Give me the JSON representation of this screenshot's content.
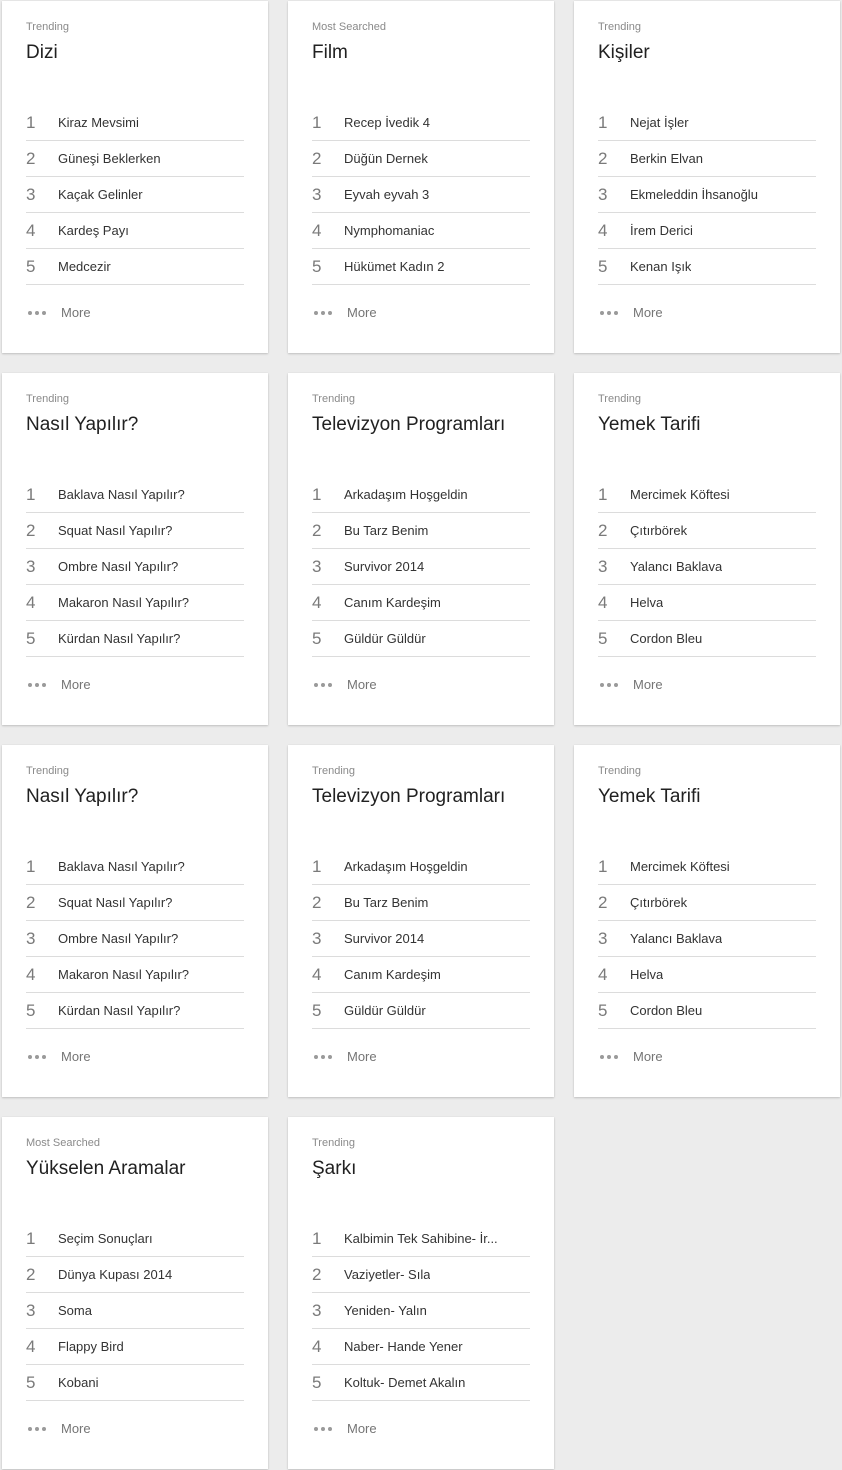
{
  "more_label": "More",
  "cards": [
    {
      "category": "Trending",
      "title": "Dizi",
      "items": [
        "Kiraz Mevsimi",
        "Güneşi Beklerken",
        "Kaçak Gelinler",
        "Kardeş Payı",
        "Medcezir"
      ]
    },
    {
      "category": "Most Searched",
      "title": "Film",
      "items": [
        "Recep İvedik 4",
        "Düğün Dernek",
        "Eyvah eyvah 3",
        "Nymphomaniac",
        "Hükümet Kadın 2"
      ]
    },
    {
      "category": "Trending",
      "title": "Kişiler",
      "items": [
        "Nejat İşler",
        "Berkin Elvan",
        "Ekmeleddin İhsanoğlu",
        "İrem Derici",
        "Kenan Işık"
      ]
    },
    {
      "category": "Trending",
      "title": "Nasıl Yapılır?",
      "items": [
        "Baklava Nasıl Yapılır?",
        "Squat Nasıl Yapılır?",
        "Ombre Nasıl Yapılır?",
        "Makaron Nasıl Yapılır?",
        "Kürdan Nasıl Yapılır?"
      ]
    },
    {
      "category": "Trending",
      "title": "Televizyon Programları",
      "items": [
        "Arkadaşım Hoşgeldin",
        "Bu Tarz Benim",
        "Survivor 2014",
        "Canım Kardeşim",
        "Güldür Güldür"
      ]
    },
    {
      "category": "Trending",
      "title": "Yemek Tarifi",
      "items": [
        "Mercimek Köftesi",
        "Çıtırbörek",
        "Yalancı Baklava",
        "Helva",
        "Cordon Bleu"
      ]
    },
    {
      "category": "Trending",
      "title": "Nasıl Yapılır?",
      "items": [
        "Baklava Nasıl Yapılır?",
        "Squat Nasıl Yapılır?",
        "Ombre Nasıl Yapılır?",
        "Makaron Nasıl Yapılır?",
        "Kürdan Nasıl Yapılır?"
      ]
    },
    {
      "category": "Trending",
      "title": "Televizyon Programları",
      "items": [
        "Arkadaşım Hoşgeldin",
        "Bu Tarz Benim",
        "Survivor 2014",
        "Canım Kardeşim",
        "Güldür Güldür"
      ]
    },
    {
      "category": "Trending",
      "title": "Yemek Tarifi",
      "items": [
        "Mercimek Köftesi",
        "Çıtırbörek",
        "Yalancı Baklava",
        "Helva",
        "Cordon Bleu"
      ]
    },
    {
      "category": "Most Searched",
      "title": "Yükselen Aramalar",
      "items": [
        "Seçim Sonuçları",
        "Dünya Kupası 2014",
        "Soma",
        "Flappy Bird",
        "Kobani"
      ]
    },
    {
      "category": "Trending",
      "title": "Şarkı",
      "items": [
        "Kalbimin Tek Sahibine- İr...",
        "Vaziyetler- Sıla",
        "Yeniden- Yalın",
        "Naber- Hande Yener",
        "Koltuk- Demet Akalın"
      ]
    }
  ],
  "ranks": [
    "1",
    "2",
    "3",
    "4",
    "5"
  ]
}
